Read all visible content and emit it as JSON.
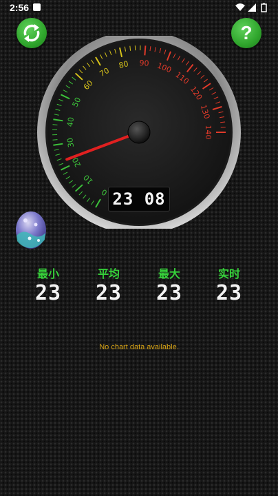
{
  "status": {
    "time": "2:56"
  },
  "header": {
    "refresh_icon": "refresh-arrows-icon",
    "help_icon": "question-mark-icon",
    "help_label": "?"
  },
  "gauge": {
    "scale_min": 0,
    "scale_max": 140,
    "tick_labels": [
      "0",
      "10",
      "20",
      "30",
      "40",
      "50",
      "60",
      "70",
      "80",
      "90",
      "100",
      "110",
      "120",
      "130",
      "140"
    ],
    "needle_value": 23,
    "lcd_text": "23 08",
    "colors": {
      "low": "#3cc23a",
      "mid": "#d6c21a",
      "high": "#e03a2a",
      "needle": "#e02020"
    }
  },
  "stats": {
    "min_label": "最小",
    "min_value": "23",
    "avg_label": "平均",
    "avg_value": "23",
    "max_label": "最大",
    "max_value": "23",
    "real_label": "实时",
    "real_value": "23"
  },
  "chart": {
    "empty_text": "No chart data available."
  }
}
